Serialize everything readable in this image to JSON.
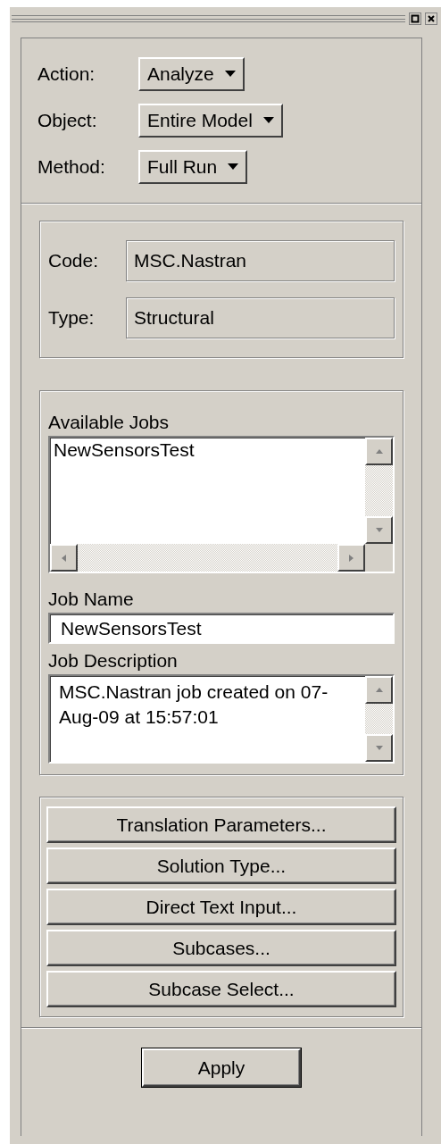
{
  "selectors": [
    {
      "label": "Action:",
      "value": "Analyze"
    },
    {
      "label": "Object:",
      "value": "Entire Model"
    },
    {
      "label": "Method:",
      "value": "Full Run"
    }
  ],
  "info": [
    {
      "label": "Code:",
      "value": "MSC.Nastran"
    },
    {
      "label": "Type:",
      "value": "Structural"
    }
  ],
  "available_jobs": {
    "label": "Available Jobs",
    "items": [
      "NewSensorsTest"
    ]
  },
  "job_name": {
    "label": "Job Name",
    "value": "NewSensorsTest"
  },
  "job_description": {
    "label": "Job Description",
    "value": "MSC.Nastran job created on 07-Aug-09 at 15:57:01"
  },
  "buttons": [
    "Translation Parameters...",
    "Solution Type...",
    "Direct Text Input...",
    "Subcases...",
    "Subcase Select..."
  ],
  "apply": "Apply"
}
